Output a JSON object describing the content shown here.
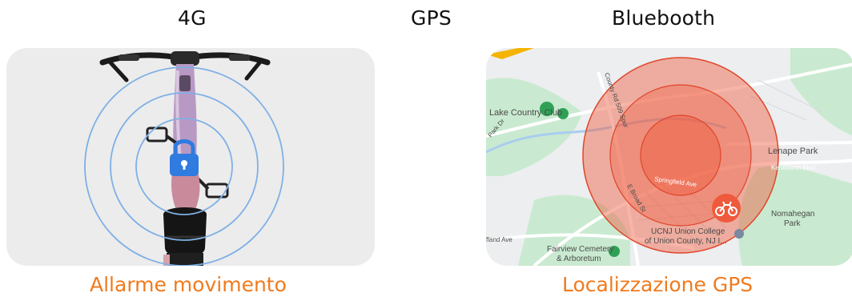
{
  "headings": {
    "four_g": "4G",
    "gps": "GPS",
    "bluetooth": "Bluebooth"
  },
  "captions": {
    "left": "Allarme movimento",
    "right": "Localizzazione GPS"
  },
  "map": {
    "labels": {
      "lake_country_club": "Lake Country Club",
      "park_dr": "Park Dr",
      "county_rd": "County Rd 509 Spur",
      "lenape_park": "Lenape Park",
      "kenilworth_blvd": "Kenilworth Blvd",
      "springfield_ave": "Springfield Ave",
      "e_broad_st": "E Broad St",
      "nomahegan_park_line1": "Nomahegan",
      "nomahegan_park_line2": "Park",
      "ucnj_line1": "UCNJ Union College",
      "ucnj_line2": "of Union County, NJ I...",
      "fairview_line1": "Fairview Cemetery",
      "fairview_line2": "& Arboretum",
      "land_ave": "fland Ave"
    }
  },
  "colors": {
    "accent_orange": "#f07b1e",
    "ring_blue": "#7fb0e6",
    "lock_blue": "#2f7be0",
    "map_circle": "#ef5a3c"
  }
}
